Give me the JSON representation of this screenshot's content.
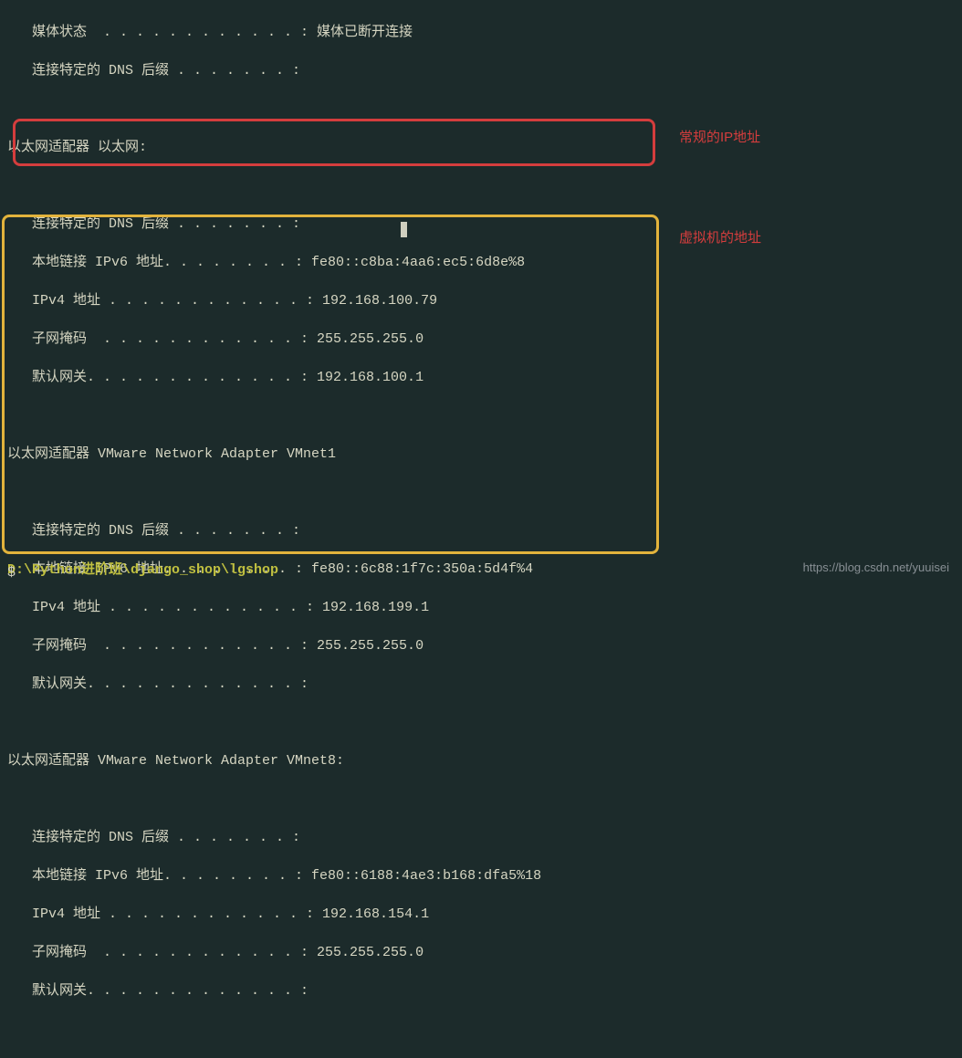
{
  "top": {
    "media_state": "   媒体状态  . . . . . . . . . . . . : 媒体已断开连接",
    "dns_suffix": "   连接特定的 DNS 后缀 . . . . . . . :"
  },
  "adapter1": {
    "title": "以太网适配器 以太网:",
    "dns": "   连接特定的 DNS 后缀 . . . . . . . :",
    "ipv6": "   本地链接 IPv6 地址. . . . . . . . : fe80::c8ba:4aa6:ec5:6d8e%8",
    "ipv4": "   IPv4 地址 . . . . . . . . . . . . : 192.168.100.79",
    "mask": "   子网掩码  . . . . . . . . . . . . : 255.255.255.0",
    "gw": "   默认网关. . . . . . . . . . . . . : 192.168.100.1"
  },
  "adapter2": {
    "title": "以太网适配器 VMware Network Adapter VMnet1",
    "dns": "   连接特定的 DNS 后缀 . . . . . . . :",
    "ipv6": "   本地链接 IPv6 地址. . . . . . . . : fe80::6c88:1f7c:350a:5d4f%4",
    "ipv4": "   IPv4 地址 . . . . . . . . . . . . : 192.168.199.1",
    "mask": "   子网掩码  . . . . . . . . . . . . : 255.255.255.0",
    "gw": "   默认网关. . . . . . . . . . . . . :"
  },
  "adapter3": {
    "title": "以太网适配器 VMware Network Adapter VMnet8:",
    "dns": "   连接特定的 DNS 后缀 . . . . . . . :",
    "ipv6": "   本地链接 IPv6 地址. . . . . . . . : fe80::6188:4ae3:b168:dfa5%18",
    "ipv4": "   IPv4 地址 . . . . . . . . . . . . : 192.168.154.1",
    "mask": "   子网掩码  . . . . . . . . . . . . : 255.255.255.0",
    "gw": "   默认网关. . . . . . . . . . . . . :"
  },
  "annotations": {
    "regular_ip": "常规的IP地址",
    "vm_address": "虚拟机的地址"
  },
  "prompt": {
    "path": "D:\\Python进阶班\\django_shop\\lgshop",
    "symbol": "$"
  },
  "watermark": "https://blog.csdn.net/yuuisei"
}
